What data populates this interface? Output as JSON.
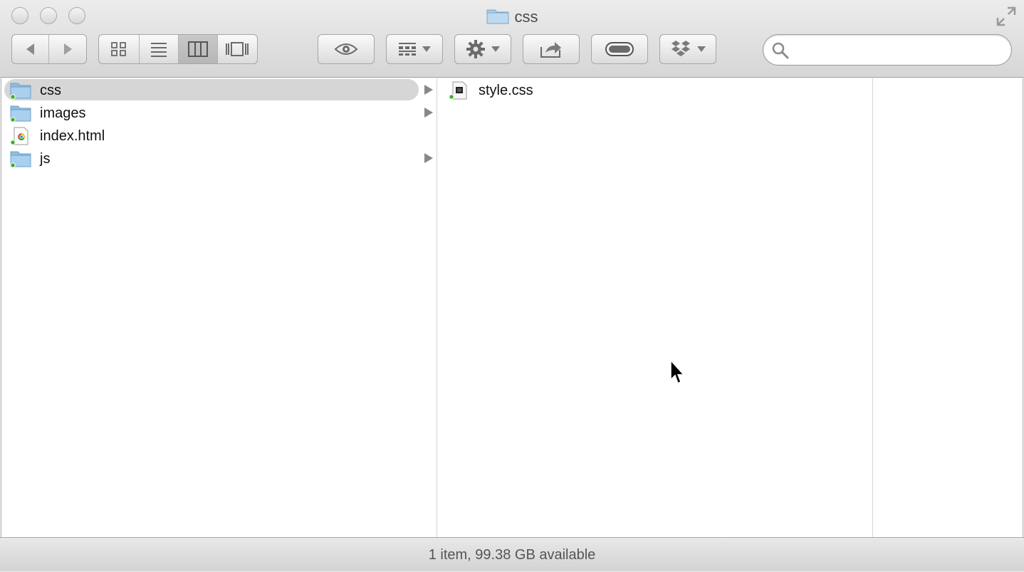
{
  "window": {
    "title": "css"
  },
  "toolbar": {
    "search": {
      "placeholder": "",
      "value": ""
    },
    "view_mode_active": "columns"
  },
  "columns": [
    {
      "items": [
        {
          "name": "css",
          "kind": "folder",
          "has_children": true,
          "selected": true
        },
        {
          "name": "images",
          "kind": "folder",
          "has_children": true,
          "selected": false
        },
        {
          "name": "index.html",
          "kind": "html-file",
          "has_children": false,
          "selected": false
        },
        {
          "name": "js",
          "kind": "folder",
          "has_children": true,
          "selected": false
        }
      ]
    },
    {
      "items": [
        {
          "name": "style.css",
          "kind": "css-file",
          "has_children": false,
          "selected": false
        }
      ]
    }
  ],
  "status": {
    "text": "1 item, 99.38 GB available"
  },
  "colors": {
    "selection": "#d6d6d6",
    "folder": "#8fc3e8",
    "sync_badge": "#3fae2a"
  }
}
